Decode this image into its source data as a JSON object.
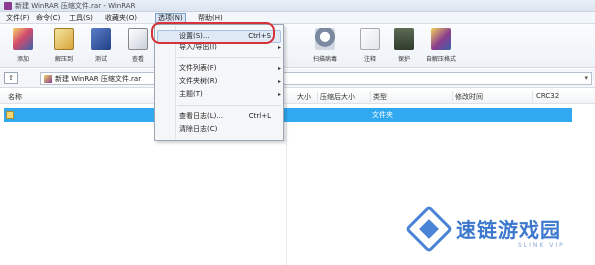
{
  "window": {
    "title": "新建 WinRAR 压缩文件.rar - WinRAR"
  },
  "menubar": {
    "items": [
      {
        "label": "文件(F)"
      },
      {
        "label": "命令(C)"
      },
      {
        "label": "工具(S)"
      },
      {
        "label": "收藏夹(O)"
      },
      {
        "label": "选项(N)"
      },
      {
        "label": "帮助(H)"
      }
    ]
  },
  "toolbar": {
    "buttons": [
      {
        "label": "添加",
        "icon": "add-icon"
      },
      {
        "label": "解压到",
        "icon": "extract-icon"
      },
      {
        "label": "测试",
        "icon": "test-icon"
      },
      {
        "label": "查看",
        "icon": "view-icon"
      },
      {
        "label": "扫描病毒",
        "icon": "scan-icon"
      },
      {
        "label": "注释",
        "icon": "comment-icon"
      },
      {
        "label": "保护",
        "icon": "protect-icon"
      },
      {
        "label": "自解压格式",
        "icon": "sfx-icon"
      }
    ]
  },
  "address": {
    "up_glyph": "⇧",
    "path": "新建 WinRAR 压缩文件.rar",
    "dropdown_glyph": "▾"
  },
  "columns": {
    "name": "名称",
    "size": "大小",
    "packed": "压缩后大小",
    "type": "类型",
    "modified": "修改时间",
    "crc": "CRC32"
  },
  "files": [
    {
      "type": "文件夹"
    }
  ],
  "options_menu": {
    "items": [
      {
        "label": "设置(S)...",
        "shortcut": "Ctrl+S",
        "arrow": ""
      },
      {
        "label": "导入/导出(I)",
        "shortcut": "",
        "arrow": "▸"
      },
      {
        "label": "文件列表(F)",
        "shortcut": "",
        "arrow": "▸"
      },
      {
        "label": "文件夹树(R)",
        "shortcut": "",
        "arrow": "▸"
      },
      {
        "label": "主题(T)",
        "shortcut": "",
        "arrow": "▸"
      },
      {
        "label": "查看日志(L)...",
        "shortcut": "Ctrl+L",
        "arrow": ""
      },
      {
        "label": "清除日志(C)",
        "shortcut": "",
        "arrow": ""
      }
    ]
  },
  "watermark": {
    "text": "速链游戏园",
    "subtext": "SLINK VIP"
  },
  "colors": {
    "selection": "#30a9f0",
    "highlight_circle": "#d6323a",
    "watermark": "#3c78cd"
  }
}
